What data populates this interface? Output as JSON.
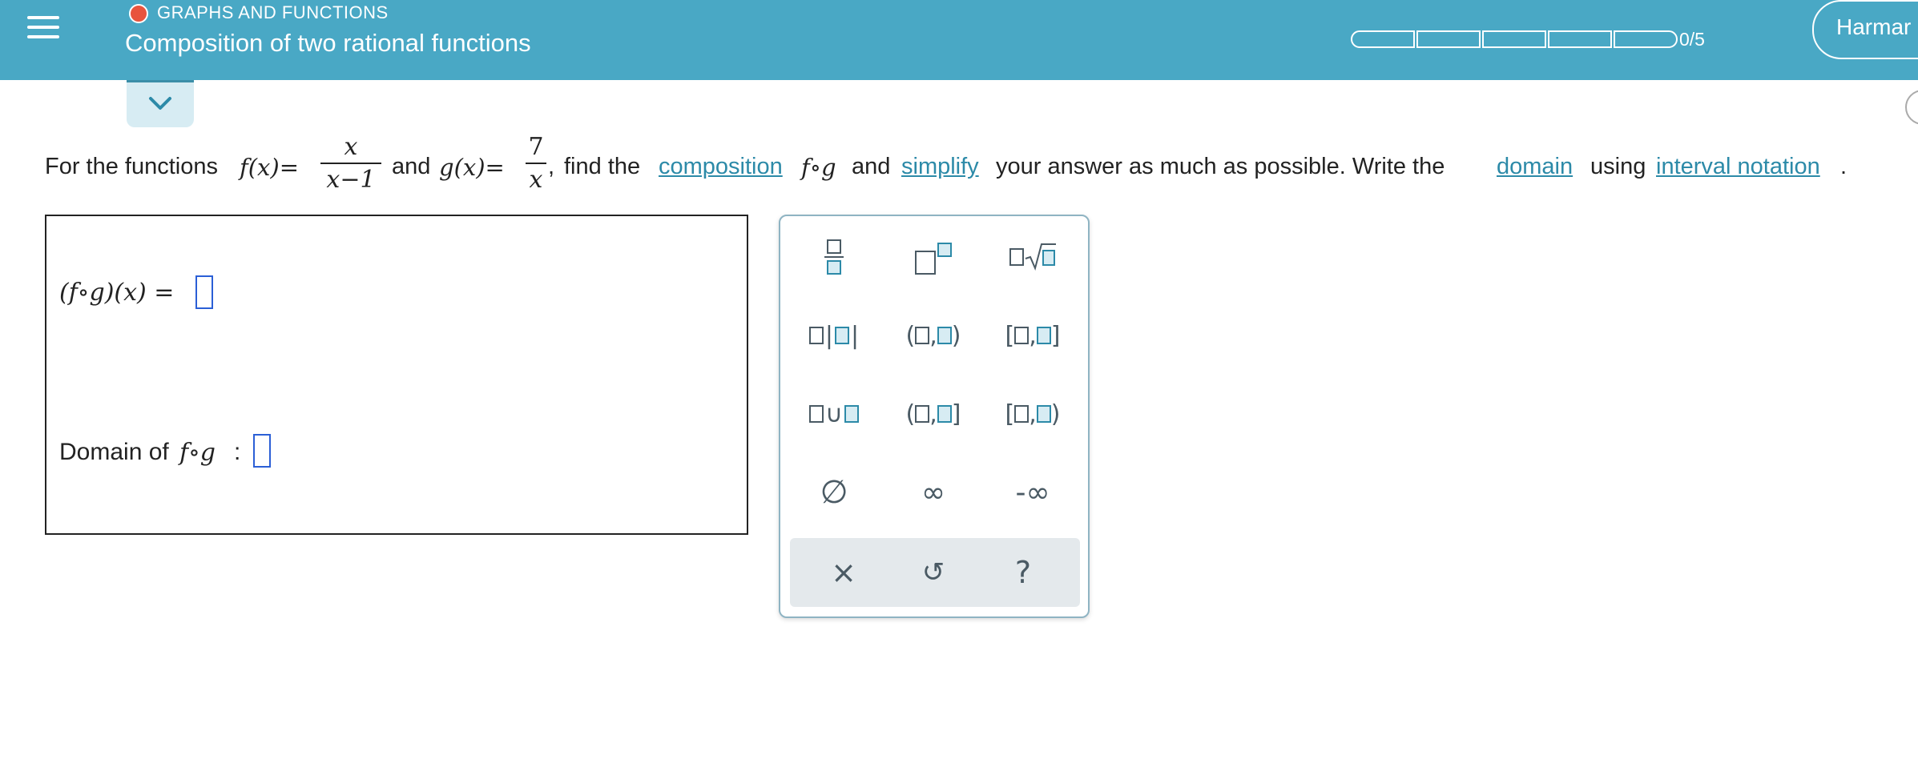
{
  "header": {
    "topic": "GRAPHS AND FUNCTIONS",
    "title": "Composition of two rational functions",
    "progress_text": "0/5",
    "progress_completed": 0,
    "progress_total": 5,
    "user_label": "Harmar",
    "accent_color": "#49a8c5",
    "topic_dot_color": "#e8543d"
  },
  "problem": {
    "intro": "For the functions",
    "f_lhs": "f(x)=",
    "f_num": "x",
    "f_den": "x−1",
    "and_1": "and",
    "g_lhs": "g(x)=",
    "g_num": "7",
    "g_den": "x",
    "comma": ",",
    "find_the": "find the",
    "composition_link": "composition",
    "fog": "f∘g",
    "and_2": "and",
    "simplify_link": "simplify",
    "middle": "your answer as much as possible. Write the",
    "domain_link": "domain",
    "using": "using",
    "interval_link": "interval notation",
    "period": "."
  },
  "answer": {
    "composition_label": "(f∘g)(x) =",
    "domain_label": "Domain of",
    "domain_fog": "f∘g",
    "domain_colon": ":"
  },
  "keypad": {
    "empty_set": "∅",
    "infinity": "∞",
    "neg_infinity": "-∞",
    "clear": "×",
    "undo": "↺",
    "help": "?"
  }
}
